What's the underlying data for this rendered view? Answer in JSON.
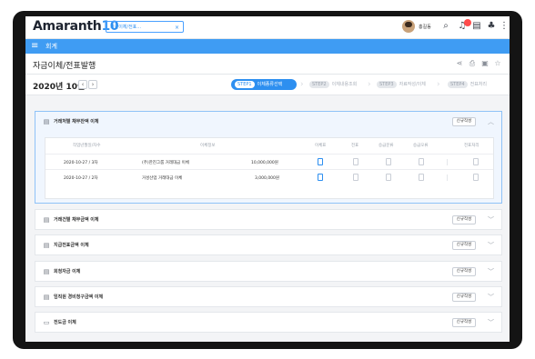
{
  "app": {
    "brand": "Amaranth",
    "version": "10",
    "user": "홍길동"
  },
  "tab": {
    "label": "자금이체/전표...",
    "close": "×"
  },
  "menu": {
    "title": "회계"
  },
  "page": {
    "title": "자금이체/전표발행",
    "month": "2020년 10월"
  },
  "steps": [
    {
      "num": "STEP1",
      "label": "이체종류선택",
      "active": true
    },
    {
      "num": "STEP2",
      "label": "이체내용조회",
      "active": false
    },
    {
      "num": "STEP3",
      "label": "자료작성/이체",
      "active": false
    },
    {
      "num": "STEP4",
      "label": "전표처리",
      "active": false
    }
  ],
  "new_button_label": "신규작성",
  "sections": [
    {
      "title": "거래처별 채무잔액 이체",
      "expanded": true
    },
    {
      "title": "거래건별 채무금액 이체",
      "expanded": false
    },
    {
      "title": "지급전표금액 이체",
      "expanded": false
    },
    {
      "title": "회청자금 이체",
      "expanded": false
    },
    {
      "title": "임직원 경비청구금액 이체",
      "expanded": false
    },
    {
      "title": "전도금 이체",
      "expanded": false
    }
  ],
  "table": {
    "headers": [
      "작업년월일/차수",
      "이체정보",
      "이체표",
      "전표",
      "승급문류",
      "승급오류",
      "전표처리"
    ],
    "rows": [
      {
        "date": "2020-10-27 / 3차",
        "info": "(주)한진그룹 거래대금 이체",
        "amount": "10,000,000원"
      },
      {
        "date": "2020-10-27 / 2차",
        "info": "거성산업 거래대금 이체",
        "amount": "3,000,000원"
      }
    ]
  },
  "colors": {
    "accent": "#2d8ff0",
    "menubar": "#3f9cf3"
  }
}
